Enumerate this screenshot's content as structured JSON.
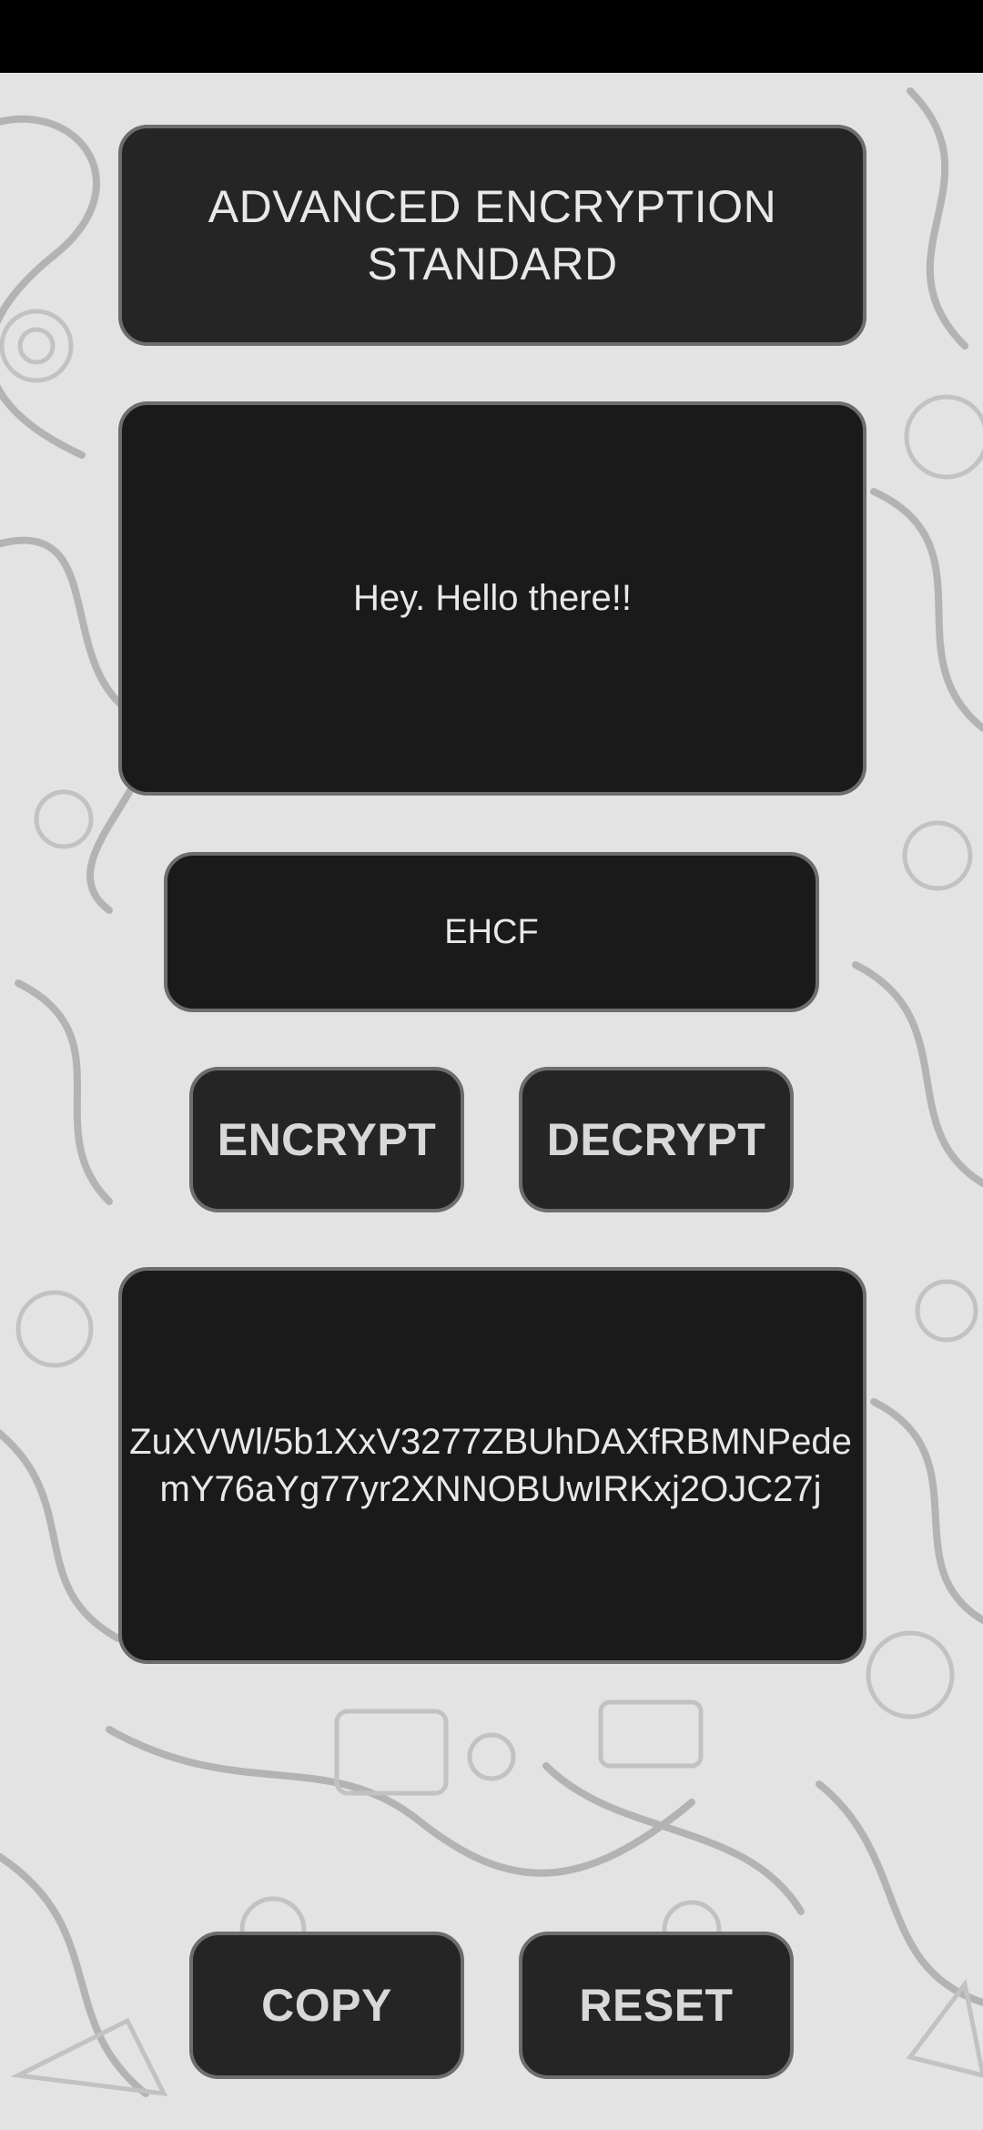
{
  "app": {
    "title_line1": "ADVANCED ENCRYPTION",
    "title_line2": "STANDARD"
  },
  "message": {
    "value": "Hey. Hello there!!"
  },
  "key": {
    "value": "EHCF"
  },
  "actions": {
    "encrypt_label": "ENCRYPT",
    "decrypt_label": "DECRYPT",
    "copy_label": "COPY",
    "reset_label": "RESET"
  },
  "output": {
    "value": "ZuXVWl/5b1XxV3277ZBUhDAXfRBMNPedemY76aYg77yr2XNNOBUwIRKxj2OJC27j"
  },
  "theme": {
    "background": "#e3e3e3",
    "doodle_line": "#b0b0b0",
    "card_dark": "#252525",
    "field_dark": "#1a1a1a",
    "border": "#6d6d6d",
    "text": "#e8e8e8"
  }
}
